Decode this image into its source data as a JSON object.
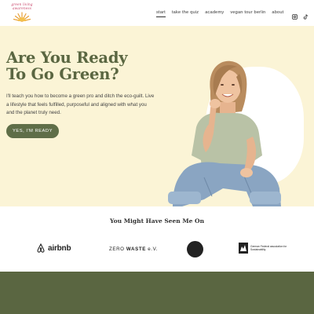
{
  "header": {
    "logo_text": "green living awareness",
    "nav": [
      {
        "label": "start",
        "active": true
      },
      {
        "label": "take the quiz",
        "active": false
      },
      {
        "label": "academy",
        "active": false
      },
      {
        "label": "vegan tour berlin",
        "active": false
      },
      {
        "label": "about",
        "active": false
      }
    ],
    "social_icons": [
      "instagram-icon",
      "tiktok-icon"
    ]
  },
  "hero": {
    "title_line1": "Are You Ready",
    "title_line2": "To Go Green?",
    "body": "I'll teach you how to become a green pro and ditch the eco-guilt. Live a lifestyle that feels fulfilled, purposeful and aligned with what you and the planet truly need.",
    "cta_label": "YES, I'M READY"
  },
  "seen_on": {
    "title": "You Might Have Seen Me On",
    "logos": {
      "airbnb": "airbnb",
      "zero_a": "ZERO ",
      "zero_b": "WASTE",
      "zero_c": " e.V.",
      "circle": "",
      "assoc": "German Federal association for Sustainability"
    }
  },
  "colors": {
    "accent": "#5a6641",
    "hero_bg": "#fbf4d6",
    "button": "#5f6e48",
    "logo_pink": "#c9486c",
    "logo_orange": "#e8a13a"
  }
}
